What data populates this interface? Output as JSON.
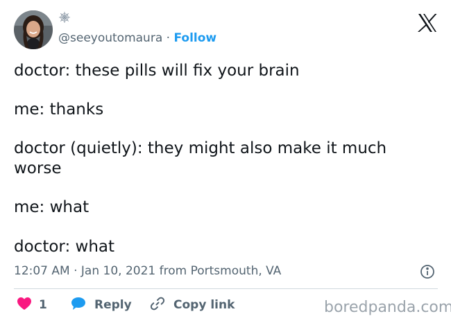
{
  "user": {
    "handle": "@seeyoutomaura",
    "separator": " · ",
    "follow_label": "Follow",
    "badge_icon": "spiderweb-icon"
  },
  "tweet": {
    "lines": [
      "doctor: these pills will fix your brain",
      "me: thanks",
      "doctor (quietly): they might also make it much",
      "worse",
      "me: what",
      "doctor: what"
    ]
  },
  "meta": {
    "time": "12:07 AM",
    "separator": " · ",
    "date": "Jan 10, 2021",
    "location_text": " from Portsmouth, VA"
  },
  "actions": {
    "like_count": "1",
    "reply_label": "Reply",
    "copy_label": "Copy link"
  },
  "watermark": "boredpanda.com",
  "colors": {
    "like": "#f91880",
    "reply": "#1d9bf0",
    "follow": "#1d9bf0",
    "muted": "#536471"
  },
  "icons": {
    "logo": "x-logo-icon",
    "info": "info-icon",
    "like": "heart-icon",
    "reply": "speech-bubble-icon",
    "copy": "link-icon"
  }
}
